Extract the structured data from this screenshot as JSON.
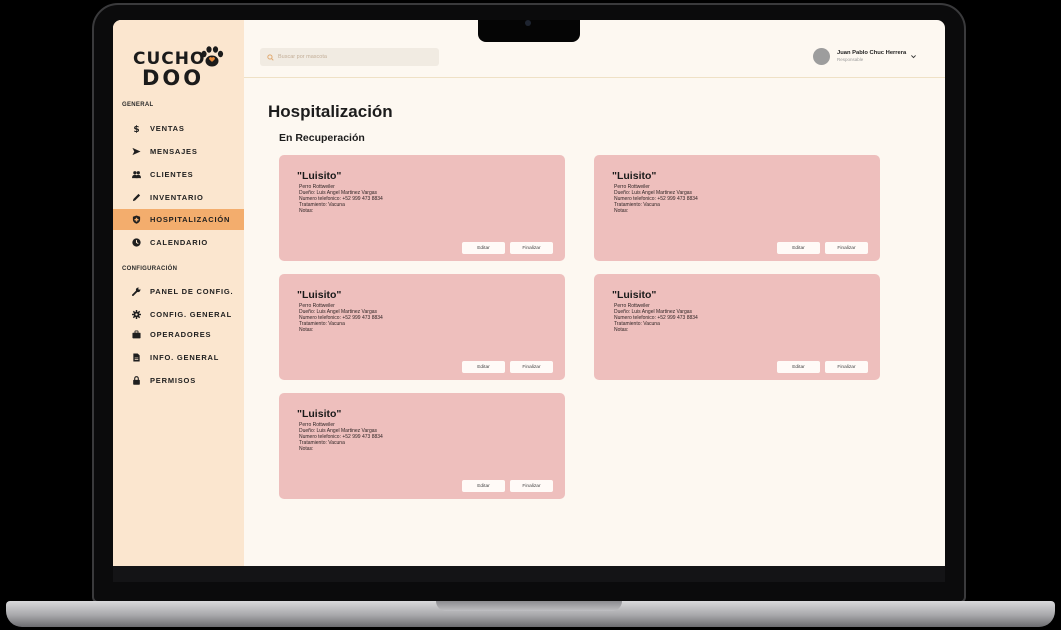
{
  "brand": {
    "line1": "CUCHO",
    "line2": "DOO"
  },
  "sidebar": {
    "section_general": "GENERAL",
    "section_config": "CONFIGURACIÓN",
    "general_items": [
      {
        "label": "VENTAS",
        "icon": "dollar-icon"
      },
      {
        "label": "MENSAJES",
        "icon": "send-icon"
      },
      {
        "label": "CLIENTES",
        "icon": "users-icon"
      },
      {
        "label": "INVENTARIO",
        "icon": "pencil-icon"
      },
      {
        "label": "HOSPITALIZACIÓN",
        "icon": "shield-icon",
        "active": true
      },
      {
        "label": "CALENDARIO",
        "icon": "clock-icon"
      }
    ],
    "config_items": [
      {
        "label": "PANEL DE CONFIG.",
        "icon": "wrench-icon"
      },
      {
        "label": "CONFIG. GENERAL",
        "icon": "gear-icon"
      },
      {
        "label": "OPERADORES",
        "icon": "briefcase-icon"
      },
      {
        "label": "INFO. GENERAL",
        "icon": "file-icon"
      },
      {
        "label": "PERMISOS",
        "icon": "lock-icon"
      }
    ]
  },
  "header": {
    "search_placeholder": "Buscar por mascota",
    "user_name": "Juan Pablo Chuc Herrera",
    "user_role": "Responsable"
  },
  "main": {
    "title": "Hospitalización",
    "section": "En Recuperación",
    "cards": [
      {
        "name": "\"Luisito\"",
        "breed": "Perro Rottweiler",
        "owner": "Dueño: Luis Angel Martinez Vargas",
        "phone": "Numero telefonico: +52 999 473 8834",
        "treatment": "Tratamiento: Vacuna",
        "notes": "Notas:",
        "edit_label": "Editar",
        "finish_label": "Finalizar"
      },
      {
        "name": "\"Luisito\"",
        "breed": "Perro Rottweiler",
        "owner": "Dueño: Luis Angel Martinez Vargas",
        "phone": "Numero telefonico: +52 999 473 8834",
        "treatment": "Tratamiento: Vacuna",
        "notes": "Notas:",
        "edit_label": "Editar",
        "finish_label": "Finalizar"
      },
      {
        "name": "\"Luisito\"",
        "breed": "Perro Rottweiler",
        "owner": "Dueño: Luis Angel Martinez Vargas",
        "phone": "Numero telefonico: +52 999 473 8834",
        "treatment": "Tratamiento: Vacuna",
        "notes": "Notas:",
        "edit_label": "Editar",
        "finish_label": "Finalizar"
      },
      {
        "name": "\"Luisito\"",
        "breed": "Perro Rottweiler",
        "owner": "Dueño: Luis Angel Martinez Vargas",
        "phone": "Numero telefonico: +52 999 473 8834",
        "treatment": "Tratamiento: Vacuna",
        "notes": "Notas:",
        "edit_label": "Editar",
        "finish_label": "Finalizar"
      },
      {
        "name": "\"Luisito\"",
        "breed": "Perro Rottweiler",
        "owner": "Dueño: Luis Angel Martinez Vargas",
        "phone": "Numero telefonico: +52 999 473 8834",
        "treatment": "Tratamiento: Vacuna",
        "notes": "Notas:",
        "edit_label": "Editar",
        "finish_label": "Finalizar"
      }
    ]
  },
  "colors": {
    "sidebar_bg": "#fbe6cf",
    "active_item": "#f3ad6d",
    "card_bg": "#eebfbd",
    "page_bg": "#fdf8f1"
  }
}
